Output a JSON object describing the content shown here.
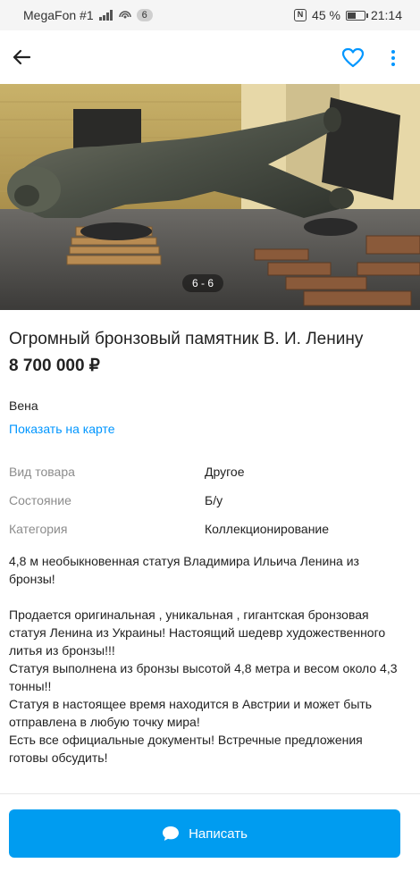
{
  "status_bar": {
    "carrier": "MegaFon #1",
    "notification_count": "6",
    "battery": "45 %",
    "time": "21:14"
  },
  "gallery": {
    "counter": "6 - 6"
  },
  "listing": {
    "title": "Огромный бронзовый памятник В. И. Ленину",
    "price": "8 700 000 ₽",
    "city": "Вена",
    "map_link": "Показать на карте",
    "params": [
      {
        "name": "Вид товара",
        "value": "Другое"
      },
      {
        "name": "Состояние",
        "value": "Б/у"
      },
      {
        "name": "Категория",
        "value": "Коллекционирование"
      }
    ],
    "description": "4,8 м необыкновенная статуя Владимира Ильича Ленина из бронзы!\n\nПродается  оригинальная , уникальная , гигантская бронзовая статуя Ленина из Украины! Настоящий шедевр художественного литья из бронзы!!!\nСтатуя выполнена из бронзы высотой 4,8 метра и весом около 4,3 тонны!!\nСтатуя в настоящее время находится в Австрии и может быть отправлена в любую точку мира!\nЕсть все официальные документы! Встречные предложения готовы обсудить!"
  },
  "actions": {
    "write_label": "Написать"
  },
  "colors": {
    "accent": "#0096ff",
    "button": "#009cf0"
  },
  "icons": [
    "back-arrow-icon",
    "heart-icon",
    "more-vertical-icon",
    "chat-bubble-icon"
  ]
}
